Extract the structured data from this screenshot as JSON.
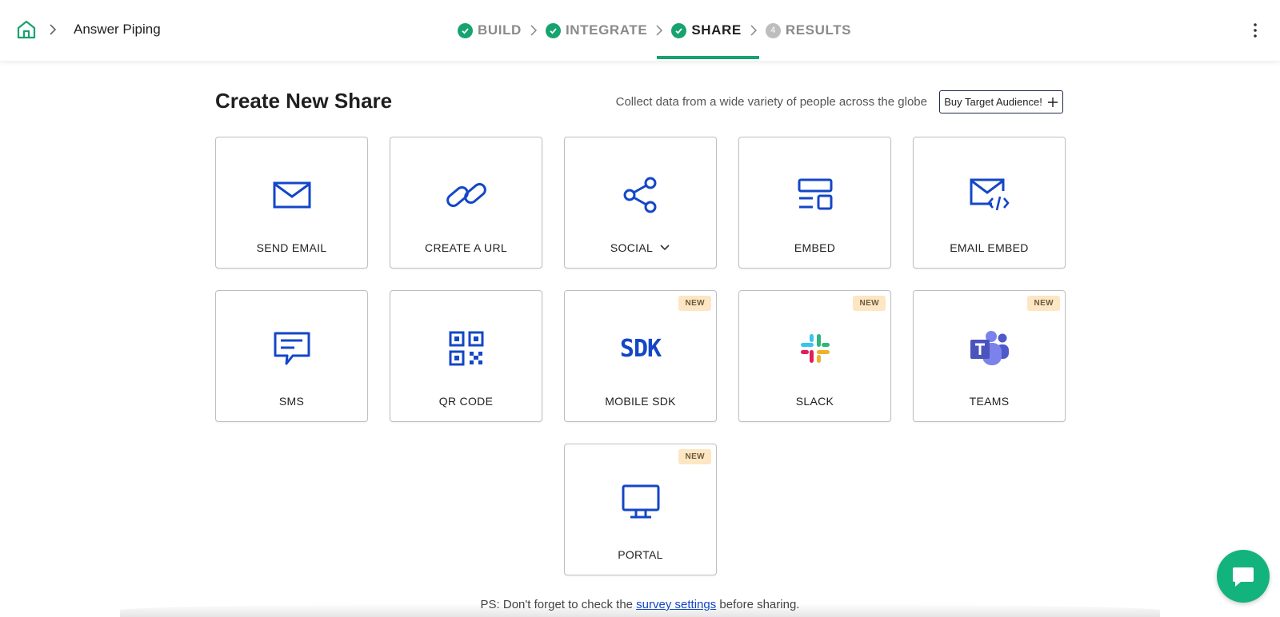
{
  "header": {
    "survey_name": "Answer Piping",
    "steps": [
      {
        "label": "BUILD",
        "state": "done"
      },
      {
        "label": "INTEGRATE",
        "state": "done"
      },
      {
        "label": "SHARE",
        "state": "active"
      },
      {
        "label": "RESULTS",
        "state": "pending",
        "number": "4"
      }
    ]
  },
  "main": {
    "title": "Create New Share",
    "subtext": "Collect data from a wide variety of people across the globe",
    "buy_button_label": "Buy Target Audience!"
  },
  "tiles": [
    {
      "label": "SEND EMAIL",
      "icon": "envelope-icon"
    },
    {
      "label": "CREATE A URL",
      "icon": "link-icon"
    },
    {
      "label": "SOCIAL",
      "icon": "share-icon"
    },
    {
      "label": "EMBED",
      "icon": "embed-icon"
    },
    {
      "label": "EMAIL EMBED",
      "icon": "email-code-icon"
    },
    {
      "label": "SMS",
      "icon": "chat-bubble-icon"
    },
    {
      "label": "QR CODE",
      "icon": "qr-code-icon"
    },
    {
      "label": "MOBILE SDK",
      "icon": "sdk-icon",
      "icon_text": "SDK",
      "badge": "NEW"
    },
    {
      "label": "SLACK",
      "icon": "slack-icon",
      "badge": "NEW"
    },
    {
      "label": "TEAMS",
      "icon": "teams-icon",
      "badge": "NEW"
    },
    {
      "label": "PORTAL",
      "icon": "monitor-icon",
      "badge": "NEW"
    }
  ],
  "footer": {
    "prefix": "PS: Don't forget to check the",
    "link": "survey settings",
    "suffix": "before sharing."
  },
  "colors": {
    "accent_green": "#16a36f",
    "icon_blue": "#1447c7",
    "badge_bg": "#fde6c3",
    "chat_fab": "#13b37e"
  }
}
